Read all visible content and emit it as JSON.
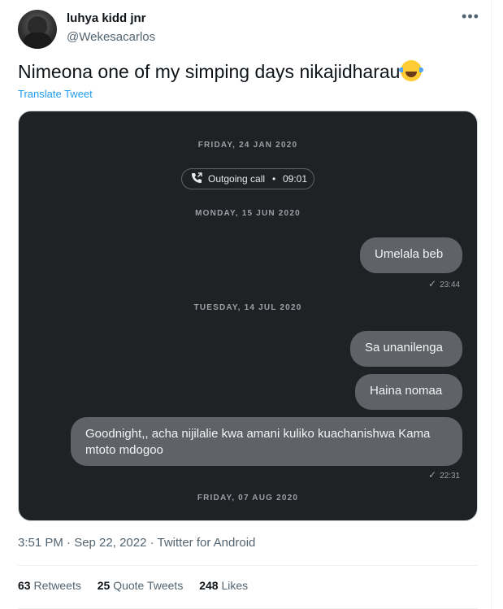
{
  "tweet": {
    "display_name": "luhya kidd jnr",
    "handle": "@Wekesacarlos",
    "more_icon": "more-horizontal-icon",
    "text": "Nimeona one of my simping days nikajidharau",
    "emoji": "face-with-tears-of-joy",
    "translate_label": "Translate Tweet",
    "timestamp": "3:51 PM · Sep 22, 2022 · Twitter for Android",
    "stats": {
      "retweets_count": "63",
      "retweets_label": "Retweets",
      "quote_count": "25",
      "quote_label": "Quote Tweets",
      "likes_count": "248",
      "likes_label": "Likes"
    }
  },
  "chat": {
    "date1": "FRIDAY, 24 JAN 2020",
    "call": {
      "icon": "outgoing-call-icon",
      "label": "Outgoing call",
      "separator": "•",
      "time": "09:01"
    },
    "date2": "MONDAY, 15 JUN 2020",
    "msg1": "Umelala beb",
    "msg1_time": "23:44",
    "date3": "TUESDAY, 14 JUL 2020",
    "msg2": "Sa unanilenga",
    "msg3": "Haina nomaa",
    "msg4": "Goodnight,, acha nijilalie kwa amani kuliko kuachanishwa Kama mtoto mdogoo",
    "msg4_time": "22:31",
    "date4": "FRIDAY, 07 AUG 2020",
    "check_glyph": "✓"
  },
  "colors": {
    "chat_bg": "#202124",
    "bubble": "#5f6368",
    "link": "#1d9bf0"
  }
}
